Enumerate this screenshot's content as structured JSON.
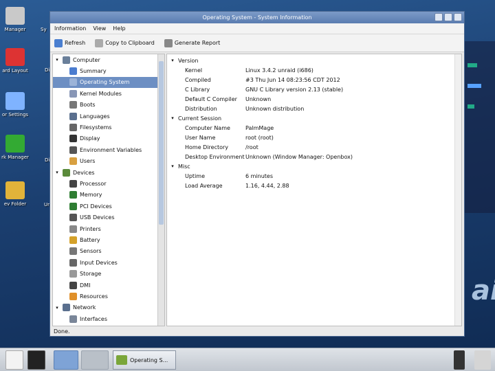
{
  "desktop": {
    "icons": [
      {
        "label": "Manager",
        "icon": "file-manager-icon",
        "color": "#c9c9c9"
      },
      {
        "label": "ard Layout",
        "icon": "keyboard-layout-icon",
        "color": "#d33"
      },
      {
        "label": "or Settings",
        "icon": "monitor-settings-icon",
        "color": "#7fb3ff"
      },
      {
        "label": "rk Manager",
        "icon": "network-manager-icon",
        "color": "#3a3"
      },
      {
        "label": "ev Folder",
        "icon": "folder-icon",
        "color": "#e1b33a"
      }
    ],
    "side_labels": [
      "Sy",
      "Di",
      "Di",
      "Ur"
    ],
    "brand_text": "aic"
  },
  "window": {
    "title": "Operating System - System Information",
    "menu": [
      "Information",
      "View",
      "Help"
    ],
    "toolbar": [
      {
        "label": "Refresh",
        "icon": "refresh-icon",
        "color": "#4a7fd0"
      },
      {
        "label": "Copy to Clipboard",
        "icon": "clipboard-icon",
        "color": "#aaa"
      },
      {
        "label": "Generate Report",
        "icon": "report-icon",
        "color": "#888"
      }
    ],
    "tree": [
      {
        "label": "Computer",
        "depth": 0,
        "expander": "▾",
        "icon": "computer-icon",
        "color": "#6a7f9a"
      },
      {
        "label": "Summary",
        "depth": 1,
        "icon": "summary-icon",
        "color": "#4b7ccf"
      },
      {
        "label": "Operating System",
        "depth": 1,
        "icon": "os-icon",
        "color": "#9bb3d8",
        "selected": true
      },
      {
        "label": "Kernel Modules",
        "depth": 1,
        "icon": "kernel-modules-icon",
        "color": "#8896b6"
      },
      {
        "label": "Boots",
        "depth": 1,
        "icon": "boots-icon",
        "color": "#777"
      },
      {
        "label": "Languages",
        "depth": 1,
        "icon": "languages-icon",
        "color": "#5a6f8e"
      },
      {
        "label": "Filesystems",
        "depth": 1,
        "icon": "filesystems-icon",
        "color": "#666"
      },
      {
        "label": "Display",
        "depth": 1,
        "icon": "display-icon",
        "color": "#333"
      },
      {
        "label": "Environment Variables",
        "depth": 1,
        "icon": "environment-icon",
        "color": "#555"
      },
      {
        "label": "Users",
        "depth": 1,
        "icon": "users-icon",
        "color": "#d8a040"
      },
      {
        "label": "Devices",
        "depth": 0,
        "expander": "▾",
        "icon": "devices-icon",
        "color": "#5a8a3a"
      },
      {
        "label": "Processor",
        "depth": 1,
        "icon": "processor-icon",
        "color": "#444"
      },
      {
        "label": "Memory",
        "depth": 1,
        "icon": "memory-icon",
        "color": "#2e7d32"
      },
      {
        "label": "PCI Devices",
        "depth": 1,
        "icon": "pci-devices-icon",
        "color": "#2e7d32"
      },
      {
        "label": "USB Devices",
        "depth": 1,
        "icon": "usb-icon",
        "color": "#555"
      },
      {
        "label": "Printers",
        "depth": 1,
        "icon": "printer-icon",
        "color": "#888"
      },
      {
        "label": "Battery",
        "depth": 1,
        "icon": "battery-icon",
        "color": "#d4a12a"
      },
      {
        "label": "Sensors",
        "depth": 1,
        "icon": "sensors-icon",
        "color": "#777"
      },
      {
        "label": "Input Devices",
        "depth": 1,
        "icon": "keyboard-icon",
        "color": "#666"
      },
      {
        "label": "Storage",
        "depth": 1,
        "icon": "storage-icon",
        "color": "#999"
      },
      {
        "label": "DMI",
        "depth": 1,
        "icon": "dmi-icon",
        "color": "#444"
      },
      {
        "label": "Resources",
        "depth": 1,
        "icon": "resources-icon",
        "color": "#e0902a"
      },
      {
        "label": "Network",
        "depth": 0,
        "expander": "▾",
        "icon": "network-icon",
        "color": "#5a6f8e"
      },
      {
        "label": "Interfaces",
        "depth": 1,
        "icon": "interfaces-icon",
        "color": "#7a8699"
      }
    ],
    "sections": [
      {
        "title": "Version",
        "rows": [
          [
            "Kernel",
            "Linux 3.4.2 unraid (i686)"
          ],
          [
            "Compiled",
            "#3 Thu Jun 14 08:23:56 CDT 2012"
          ],
          [
            "C Library",
            "GNU C Library version 2.13 (stable)"
          ],
          [
            "Default C Compiler",
            "Unknown"
          ],
          [
            "Distribution",
            "Unknown distribution"
          ]
        ]
      },
      {
        "title": "Current Session",
        "rows": [
          [
            "Computer Name",
            "PalmMage"
          ],
          [
            "User Name",
            "root (root)"
          ],
          [
            "Home Directory",
            "/root"
          ],
          [
            "Desktop Environment",
            "Unknown (Window Manager: Openbox)"
          ]
        ]
      },
      {
        "title": "Misc",
        "rows": [
          [
            "Uptime",
            "6 minutes"
          ],
          [
            "Load Average",
            "1.16, 4.44, 2.88"
          ]
        ]
      }
    ],
    "status": "Done."
  },
  "taskbar": {
    "task_label": "Operating S...",
    "colors": {
      "bar": "#c9ced5",
      "task_icon": "#7aa63a"
    }
  }
}
